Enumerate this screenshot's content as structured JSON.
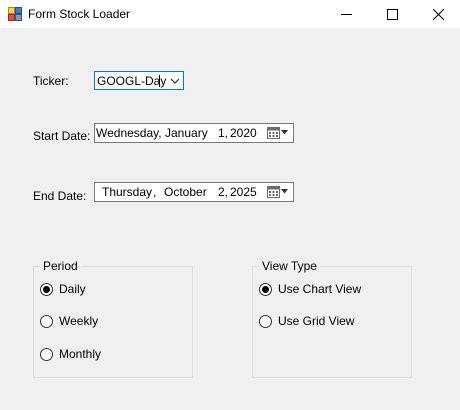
{
  "window": {
    "title": "Form Stock Loader",
    "icon": "winforms-app-icon",
    "controls": [
      "minimize-icon",
      "maximize-icon",
      "close-icon"
    ]
  },
  "ticker": {
    "label": "Ticker:",
    "value": "GOOGL-Day",
    "focused": true
  },
  "start_date": {
    "label": "Start Date:",
    "weekday": "Wednesday,",
    "month": "January",
    "day": "1,",
    "year": "2020"
  },
  "end_date": {
    "label": "End Date:",
    "weekday": "Thursday",
    "sep": ",",
    "month": "October",
    "day": "2,",
    "year": "2025"
  },
  "period": {
    "title": "Period",
    "options": [
      {
        "label": "Daily",
        "checked": true
      },
      {
        "label": "Weekly",
        "checked": false
      },
      {
        "label": "Monthly",
        "checked": false
      }
    ]
  },
  "view_type": {
    "title": "View Type",
    "options": [
      {
        "label": "Use Chart View",
        "checked": true
      },
      {
        "label": "Use Grid View",
        "checked": false
      }
    ]
  },
  "colors": {
    "form_bg": "#f0f0f0",
    "focus_border": "#0078d7",
    "radio_selected": "#000000",
    "group_border": "#dcdcdc"
  }
}
